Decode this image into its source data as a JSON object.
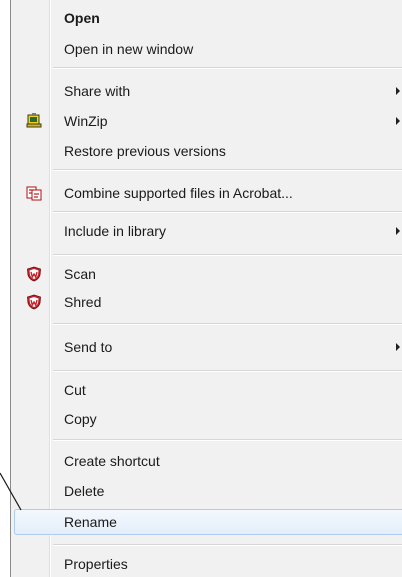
{
  "context_menu": {
    "items": [
      {
        "label": "Open"
      },
      {
        "label": "Open in new window"
      },
      {
        "label": "Share with"
      },
      {
        "label": "WinZip"
      },
      {
        "label": "Restore previous versions"
      },
      {
        "label": "Combine supported files in Acrobat..."
      },
      {
        "label": "Include in library"
      },
      {
        "label": "Scan"
      },
      {
        "label": "Shred"
      },
      {
        "label": "Send to"
      },
      {
        "label": "Cut"
      },
      {
        "label": "Copy"
      },
      {
        "label": "Create shortcut"
      },
      {
        "label": "Delete"
      },
      {
        "label": "Rename"
      },
      {
        "label": "Properties"
      }
    ],
    "icons": {
      "winzip": "winzip-icon",
      "acrobat": "acrobat-combine-icon",
      "scan": "mcafee-shield-icon",
      "shred": "mcafee-shield-icon"
    },
    "colors": {
      "background": "#f1f1f1",
      "highlight_border": "#aecbf0",
      "mcafee_red": "#c8202a"
    }
  }
}
